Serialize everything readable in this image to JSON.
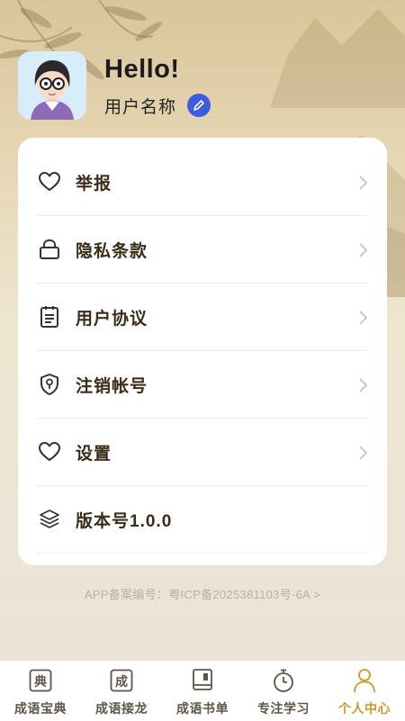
{
  "profile": {
    "greeting": "Hello!",
    "username": "用户名称",
    "avatar_icon": "cartoon-girl-avatar",
    "edit_icon": "pencil-icon"
  },
  "menu": {
    "items": [
      {
        "label": "举报",
        "icon": "heart-icon",
        "has_chevron": true
      },
      {
        "label": "隐私条款",
        "icon": "lock-icon",
        "has_chevron": true
      },
      {
        "label": "用户协议",
        "icon": "clipboard-icon",
        "has_chevron": true
      },
      {
        "label": "注销帐号",
        "icon": "shield-key-icon",
        "has_chevron": true
      },
      {
        "label": "设置",
        "icon": "heart-icon",
        "has_chevron": true
      },
      {
        "label": "版本号1.0.0",
        "icon": "layers-icon",
        "has_chevron": false
      }
    ]
  },
  "icp": "APP备案编号：粤ICP备2025381103号-6A >",
  "tabbar": {
    "tabs": [
      {
        "label": "成语宝典",
        "glyph": "典",
        "active": false
      },
      {
        "label": "成语接龙",
        "glyph": "成",
        "active": false
      },
      {
        "label": "成语书单",
        "icon": "book-icon",
        "active": false
      },
      {
        "label": "专注学习",
        "icon": "stopwatch-icon",
        "active": false
      },
      {
        "label": "个人中心",
        "icon": "person-icon",
        "active": true
      }
    ]
  },
  "colors": {
    "accent": "#c9982f",
    "edit_button": "#3d5ce0",
    "menu_text": "#3b2c17",
    "tab_text": "#5d5548"
  }
}
